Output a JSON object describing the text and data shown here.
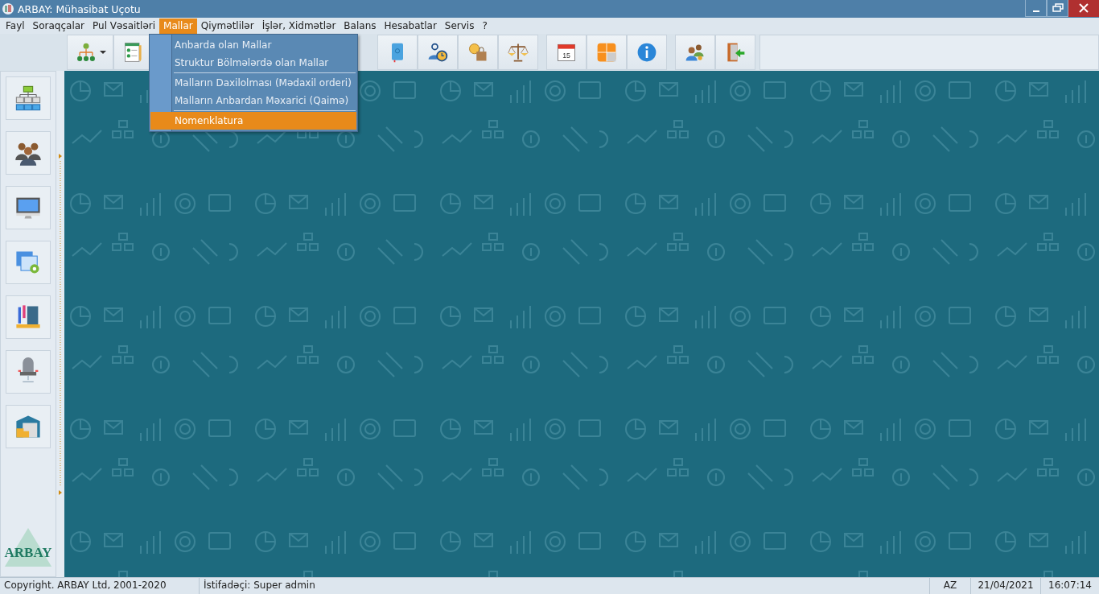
{
  "window": {
    "title": "ARBAY: Mühasibat Uçotu"
  },
  "menu_bar": [
    {
      "label": "Fayl",
      "selected": false
    },
    {
      "label": "Soraqçalar",
      "selected": false
    },
    {
      "label": "Pul Vəsaitləri",
      "selected": false
    },
    {
      "label": "Mallar",
      "selected": true
    },
    {
      "label": "Qiymətlilər",
      "selected": false
    },
    {
      "label": "İşlər, Xidmətlər",
      "selected": false
    },
    {
      "label": "Balans",
      "selected": false
    },
    {
      "label": "Hesabatlar",
      "selected": false
    },
    {
      "label": "Servis",
      "selected": false
    },
    {
      "label": "?",
      "selected": false
    }
  ],
  "dropdown": {
    "groups": [
      [
        {
          "label": "Anbarda olan Mallar",
          "selected": false
        },
        {
          "label": "Struktur Bölmələrdə olan Mallar",
          "selected": false
        }
      ],
      [
        {
          "label": "Malların Daxilolması (Mədaxil orderi)",
          "selected": false
        },
        {
          "label": "Malların Anbardan Məxarici (Qaimə)",
          "selected": false
        }
      ],
      [
        {
          "label": "Nomenklatura",
          "selected": true
        }
      ]
    ]
  },
  "toolbar": {
    "calendar_day": "15"
  },
  "sidebar": {
    "logo": "ARBAY"
  },
  "status_bar": {
    "copyright": "Copyright. ARBAY Ltd, 2001-2020",
    "user": "İstifadəçi: Super admin",
    "language": "AZ",
    "date": "21/04/2021",
    "time": "16:07:14"
  }
}
